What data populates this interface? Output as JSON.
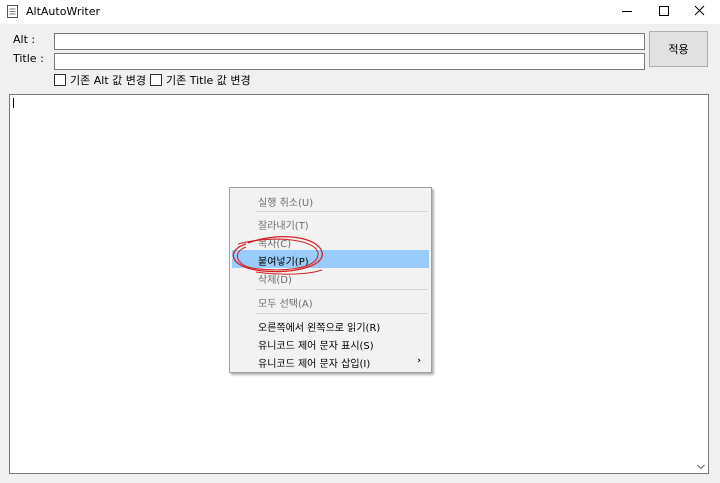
{
  "window": {
    "title": "AltAutoWriter"
  },
  "form": {
    "alt_label": "Alt :",
    "title_label": "Title :",
    "alt_value": "",
    "title_value": "",
    "apply_label": "적용",
    "check_alt_label": "기존 Alt 값 변경",
    "check_title_label": "기존 Title 값 변경",
    "check_alt_checked": false,
    "check_title_checked": false
  },
  "context_menu": {
    "items": [
      {
        "label": "실행 취소(U)",
        "enabled": false
      },
      {
        "label": "잘라내기(T)",
        "enabled": false
      },
      {
        "label": "복사(C)",
        "enabled": false
      },
      {
        "label": "붙여넣기(P)",
        "enabled": true,
        "highlighted": true
      },
      {
        "label": "삭제(D)",
        "enabled": false
      },
      {
        "label": "모두 선택(A)",
        "enabled": false
      },
      {
        "label": "오른쪽에서 왼쪽으로 읽기(R)",
        "enabled": true
      },
      {
        "label": "유니코드 제어 문자 표시(S)",
        "enabled": true
      },
      {
        "label": "유니코드 제어 문자 삽입(I)",
        "enabled": true,
        "submenu": true
      }
    ]
  },
  "colors": {
    "highlight": "#99ccf8",
    "annotation": "#d2232a"
  }
}
